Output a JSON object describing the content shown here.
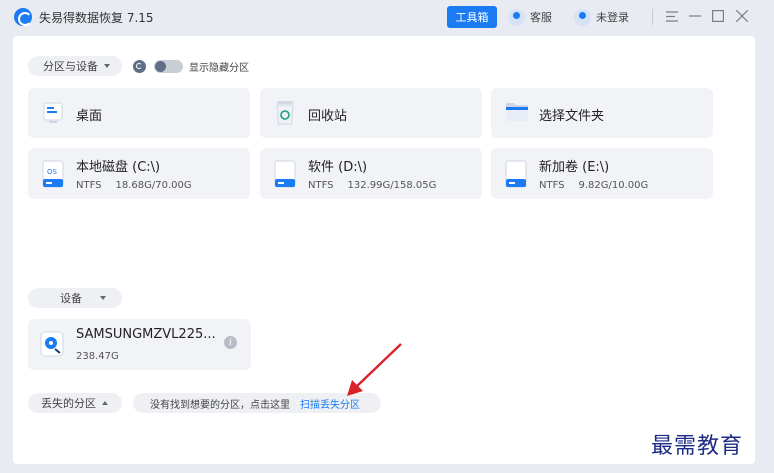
{
  "app": {
    "title": "失易得数据恢复 7.15",
    "toolbox_label": "工具箱",
    "service_label": "客服",
    "login_label": "未登录",
    "menu_icon": "menu-icon",
    "minimize_icon": "minimize-icon",
    "maximize_icon": "maximize-icon",
    "close_icon": "close-icon"
  },
  "partitions_section": {
    "dropdown_label": "分区与设备",
    "show_hidden_label": "显示隐藏分区",
    "show_hidden_on": false
  },
  "quick_locations": [
    {
      "label": "桌面",
      "icon": "desktop-icon"
    },
    {
      "label": "回收站",
      "icon": "recycle-bin-icon"
    },
    {
      "label": "选择文件夹",
      "icon": "folder-icon"
    }
  ],
  "drives": [
    {
      "label": "本地磁盘 (C:\\)",
      "fs": "NTFS",
      "usage": "18.68G/70.00G",
      "icon": "system-drive-icon"
    },
    {
      "label": "软件 (D:\\)",
      "fs": "NTFS",
      "usage": "132.99G/158.05G",
      "icon": "drive-icon"
    },
    {
      "label": "新加卷 (E:\\)",
      "fs": "NTFS",
      "usage": "9.82G/10.00G",
      "icon": "drive-icon"
    }
  ],
  "devices_section": {
    "dropdown_label": "设备",
    "device": {
      "name": "SAMSUNGMZVL225...",
      "size": "238.47G",
      "icon": "disk-device-icon",
      "info_icon": "info-icon"
    }
  },
  "lost_partitions": {
    "dropdown_label": "丢失的分区",
    "hint_text": "没有找到想要的分区，点击这里",
    "scan_link": "扫描丢失分区"
  },
  "watermark": "最需教育",
  "colors": {
    "accent": "#1a7bf2",
    "background": "#e8ebf1",
    "card": "#f1f3f6",
    "arrow": "#d9232a"
  }
}
